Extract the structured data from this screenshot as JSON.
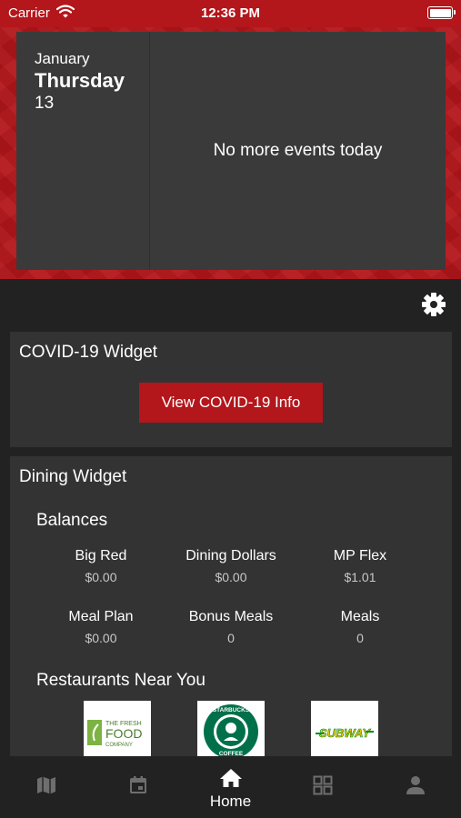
{
  "status_bar": {
    "carrier": "Carrier",
    "time": "12:36 PM"
  },
  "calendar": {
    "month": "January",
    "weekday": "Thursday",
    "day": "13",
    "empty_message": "No more events today"
  },
  "covid_widget": {
    "title": "COVID-19 Widget",
    "button_label": "View COVID-19 Info"
  },
  "dining_widget": {
    "title": "Dining Widget",
    "balances_heading": "Balances",
    "balances": [
      {
        "name": "Big Red",
        "value": "$0.00"
      },
      {
        "name": "Dining Dollars",
        "value": "$0.00"
      },
      {
        "name": "MP Flex",
        "value": "$1.01"
      },
      {
        "name": "Meal Plan",
        "value": "$0.00"
      },
      {
        "name": "Bonus Meals",
        "value": "0"
      },
      {
        "name": "Meals",
        "value": "0"
      }
    ],
    "restaurants_heading": "Restaurants Near You",
    "restaurants": [
      {
        "name": "The Fresh Food Company",
        "logo_lines": [
          "THE FRESH",
          "FOOD",
          "COMPANY"
        ]
      },
      {
        "name": "Starbucks",
        "logo_text": "STARBUCKS COFFEE"
      },
      {
        "name": "Subway",
        "logo_text": "SUBWAY"
      }
    ]
  },
  "tab_bar": {
    "tabs": [
      {
        "icon": "map-icon",
        "label": ""
      },
      {
        "icon": "calendar-icon",
        "label": ""
      },
      {
        "icon": "home-icon",
        "label": "Home",
        "active": true
      },
      {
        "icon": "grid-icon",
        "label": ""
      },
      {
        "icon": "person-icon",
        "label": ""
      }
    ]
  },
  "colors": {
    "brand_red": "#b3161b",
    "background": "#222222",
    "card": "#333333",
    "inactive_icon": "#6e6e6e"
  }
}
